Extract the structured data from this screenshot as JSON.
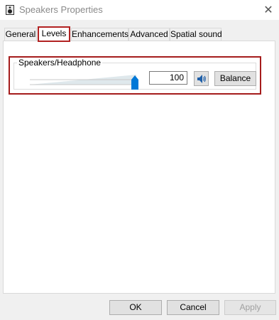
{
  "window": {
    "title": "Speakers Properties",
    "close_glyph": "✕"
  },
  "tabs": [
    {
      "label": "General",
      "active": false
    },
    {
      "label": "Levels",
      "active": true
    },
    {
      "label": "Enhancements",
      "active": false
    },
    {
      "label": "Advanced",
      "active": false
    },
    {
      "label": "Spatial sound",
      "active": false
    }
  ],
  "levels": {
    "group_label": "Speakers/Headphone",
    "volume_value": "100",
    "volume_level_percent": 100,
    "mute_icon": "speaker-volume-icon",
    "balance_label": "Balance"
  },
  "buttons": {
    "ok": "OK",
    "cancel": "Cancel",
    "apply": "Apply"
  },
  "colors": {
    "highlight": "#a51c1c",
    "accent": "#0078d7"
  }
}
